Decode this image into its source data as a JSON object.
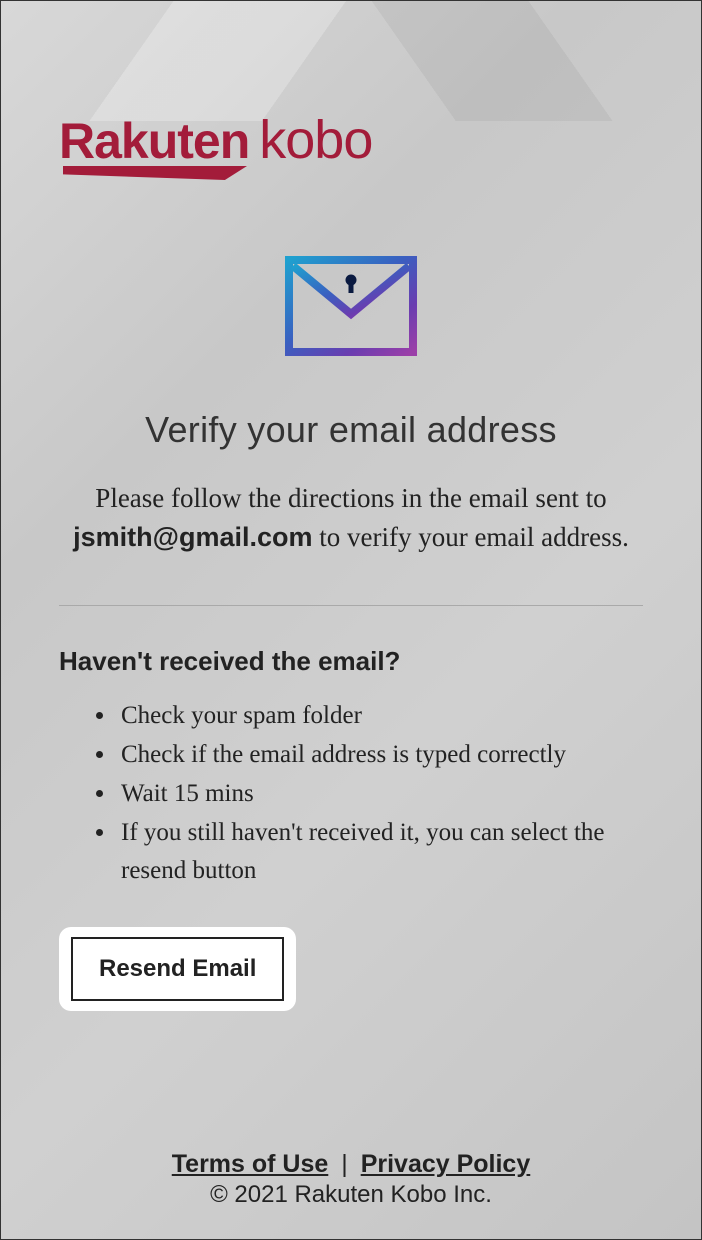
{
  "logo": {
    "brand": "Rakuten",
    "sub": "kobo"
  },
  "headline": "Verify your email address",
  "instruction": {
    "pre": "Please follow the directions in the email sent to ",
    "email": "jsmith@gmail.com",
    "post": " to verify your email address."
  },
  "help": {
    "heading": "Haven't received the email?",
    "tips": [
      "Check your spam folder",
      "Check if the email address is typed correctly",
      "Wait 15 mins",
      "If you still haven't received it,  you can select the resend button"
    ]
  },
  "resend_label": "Resend Email",
  "footer": {
    "terms": "Terms of Use",
    "sep": " | ",
    "privacy": "Privacy Policy",
    "copyright": "© 2021 Rakuten Kobo Inc."
  }
}
